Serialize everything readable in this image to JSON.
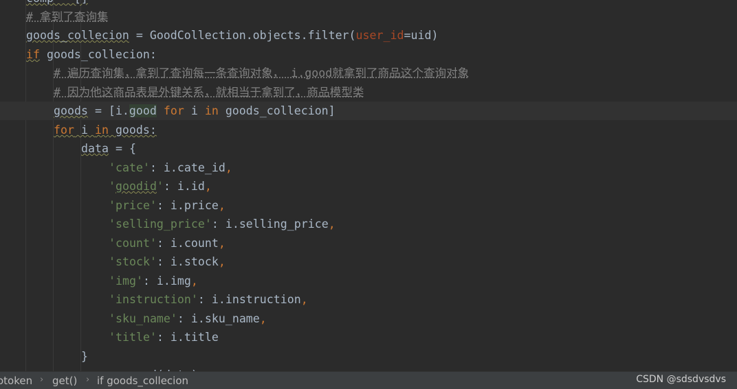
{
  "editor": {
    "lines": [
      {
        "frags": [
          {
            "t": "comp = []",
            "c": "wavy"
          }
        ]
      },
      {
        "frags": [
          {
            "t": "# 拿到了查询集",
            "c": "cm cmt"
          }
        ]
      },
      {
        "frags": [
          {
            "t": "goods_collecion",
            "c": "wavy"
          },
          {
            "t": " = GoodCollection.objects.filter(",
            "c": ""
          },
          {
            "t": "user_id",
            "c": "param"
          },
          {
            "t": "=uid)",
            "c": ""
          }
        ]
      },
      {
        "frags": [
          {
            "t": "if",
            "c": "kw wavy"
          },
          {
            "t": " goods_collecion:",
            "c": ""
          }
        ]
      },
      {
        "frags": [
          {
            "t": "# 遍历查询集，拿到了查询每一条查询对象， i.good就拿到了商品这个查询对象",
            "c": "cm cmt"
          }
        ]
      },
      {
        "frags": [
          {
            "t": "# 因为他这商品表是外键关系，就相当于拿到了，商品模型类",
            "c": "cm cmt"
          }
        ]
      },
      {
        "frags": [
          {
            "t": "goods",
            "c": "wavy"
          },
          {
            "t": " = [i.",
            "c": ""
          },
          {
            "t": "good",
            "c": "hl"
          },
          {
            "t": " ",
            "c": ""
          },
          {
            "t": "for",
            "c": "kw"
          },
          {
            "t": " i ",
            "c": ""
          },
          {
            "t": "in",
            "c": "kw"
          },
          {
            "t": " goods_collecion]",
            "c": ""
          }
        ]
      },
      {
        "frags": [
          {
            "t": "for",
            "c": "kw wavy"
          },
          {
            "t": " i ",
            "c": "wavy"
          },
          {
            "t": "in",
            "c": "kw wavy"
          },
          {
            "t": " goods:",
            "c": "wavy"
          }
        ]
      },
      {
        "frags": [
          {
            "t": "data",
            "c": "wavy"
          },
          {
            "t": " = {",
            "c": ""
          }
        ]
      },
      {
        "frags": [
          {
            "t": "'cate'",
            "c": "str"
          },
          {
            "t": ": i.cate_id",
            "c": ""
          },
          {
            "t": ",",
            "c": "kw"
          }
        ]
      },
      {
        "frags": [
          {
            "t": "'",
            "c": "str"
          },
          {
            "t": "goodid",
            "c": "str wavy"
          },
          {
            "t": "'",
            "c": "str"
          },
          {
            "t": ": i.id",
            "c": ""
          },
          {
            "t": ",",
            "c": "kw"
          }
        ]
      },
      {
        "frags": [
          {
            "t": "'price'",
            "c": "str"
          },
          {
            "t": ": i.price",
            "c": ""
          },
          {
            "t": ",",
            "c": "kw"
          }
        ]
      },
      {
        "frags": [
          {
            "t": "'selling_price'",
            "c": "str"
          },
          {
            "t": ": i.selling_price",
            "c": ""
          },
          {
            "t": ",",
            "c": "kw"
          }
        ]
      },
      {
        "frags": [
          {
            "t": "'count'",
            "c": "str"
          },
          {
            "t": ": i.count",
            "c": ""
          },
          {
            "t": ",",
            "c": "kw"
          }
        ]
      },
      {
        "frags": [
          {
            "t": "'stock'",
            "c": "str"
          },
          {
            "t": ": i.stock",
            "c": ""
          },
          {
            "t": ",",
            "c": "kw"
          }
        ]
      },
      {
        "frags": [
          {
            "t": "'img'",
            "c": "str"
          },
          {
            "t": ": i.img",
            "c": ""
          },
          {
            "t": ",",
            "c": "kw"
          }
        ]
      },
      {
        "frags": [
          {
            "t": "'instruction'",
            "c": "str"
          },
          {
            "t": ": i.instruction",
            "c": ""
          },
          {
            "t": ",",
            "c": "kw"
          }
        ]
      },
      {
        "frags": [
          {
            "t": "'sku_name'",
            "c": "str"
          },
          {
            "t": ": i.sku_name",
            "c": ""
          },
          {
            "t": ",",
            "c": "kw"
          }
        ]
      },
      {
        "frags": [
          {
            "t": "'title'",
            "c": "str"
          },
          {
            "t": ": i.title",
            "c": ""
          }
        ]
      },
      {
        "frags": [
          {
            "t": "}",
            "c": ""
          }
        ]
      },
      {
        "frags": [
          {
            "t": "comp.append(data)",
            "c": ""
          }
        ]
      }
    ]
  },
  "breadcrumb": {
    "items": [
      "otoken",
      "get()",
      "if goods_collecion"
    ],
    "separator": "›"
  },
  "watermark": "CSDN @sdsdvsdvs",
  "colors": {
    "background": "#2b2b2b",
    "keyword": "#cc7832",
    "string": "#6a8759",
    "comment": "#808080",
    "param": "#aa4926",
    "text": "#a9b7c6"
  }
}
